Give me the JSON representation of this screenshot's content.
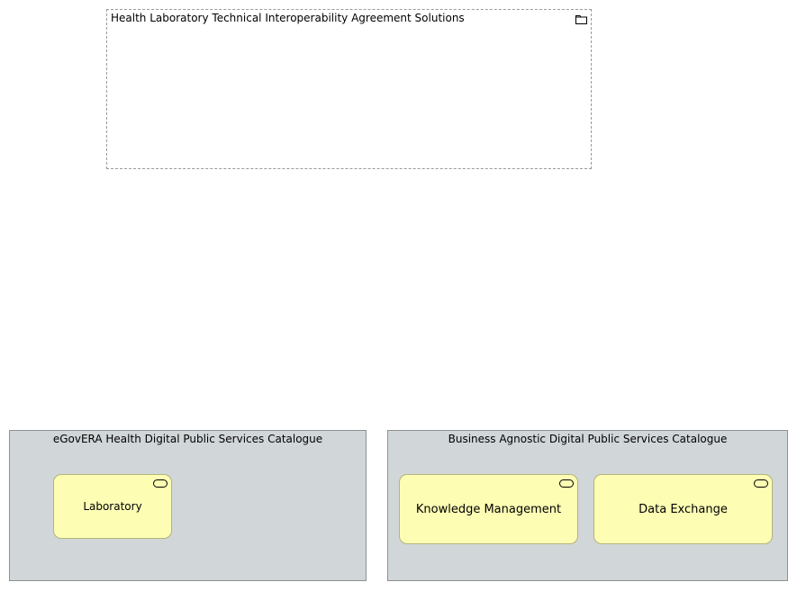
{
  "grouping": {
    "title": "Health Laboratory Technical Interoperability Agreement Solutions",
    "icon": "folder-icon"
  },
  "catalogues": {
    "egovera": {
      "title": "eGovERA Health Digital Public Services Catalogue",
      "services": [
        {
          "label": "Laboratory",
          "icon": "service-icon"
        }
      ]
    },
    "agnostic": {
      "title": "Business Agnostic Digital Public Services Catalogue",
      "services": [
        {
          "label": "Knowledge Management",
          "icon": "service-icon"
        },
        {
          "label": "Data Exchange",
          "icon": "service-icon"
        }
      ]
    }
  },
  "colors": {
    "service_fill": "#fdfdb4",
    "catalogue_fill": "#d1d6d8",
    "grouping_border": "#9a9a9a"
  }
}
